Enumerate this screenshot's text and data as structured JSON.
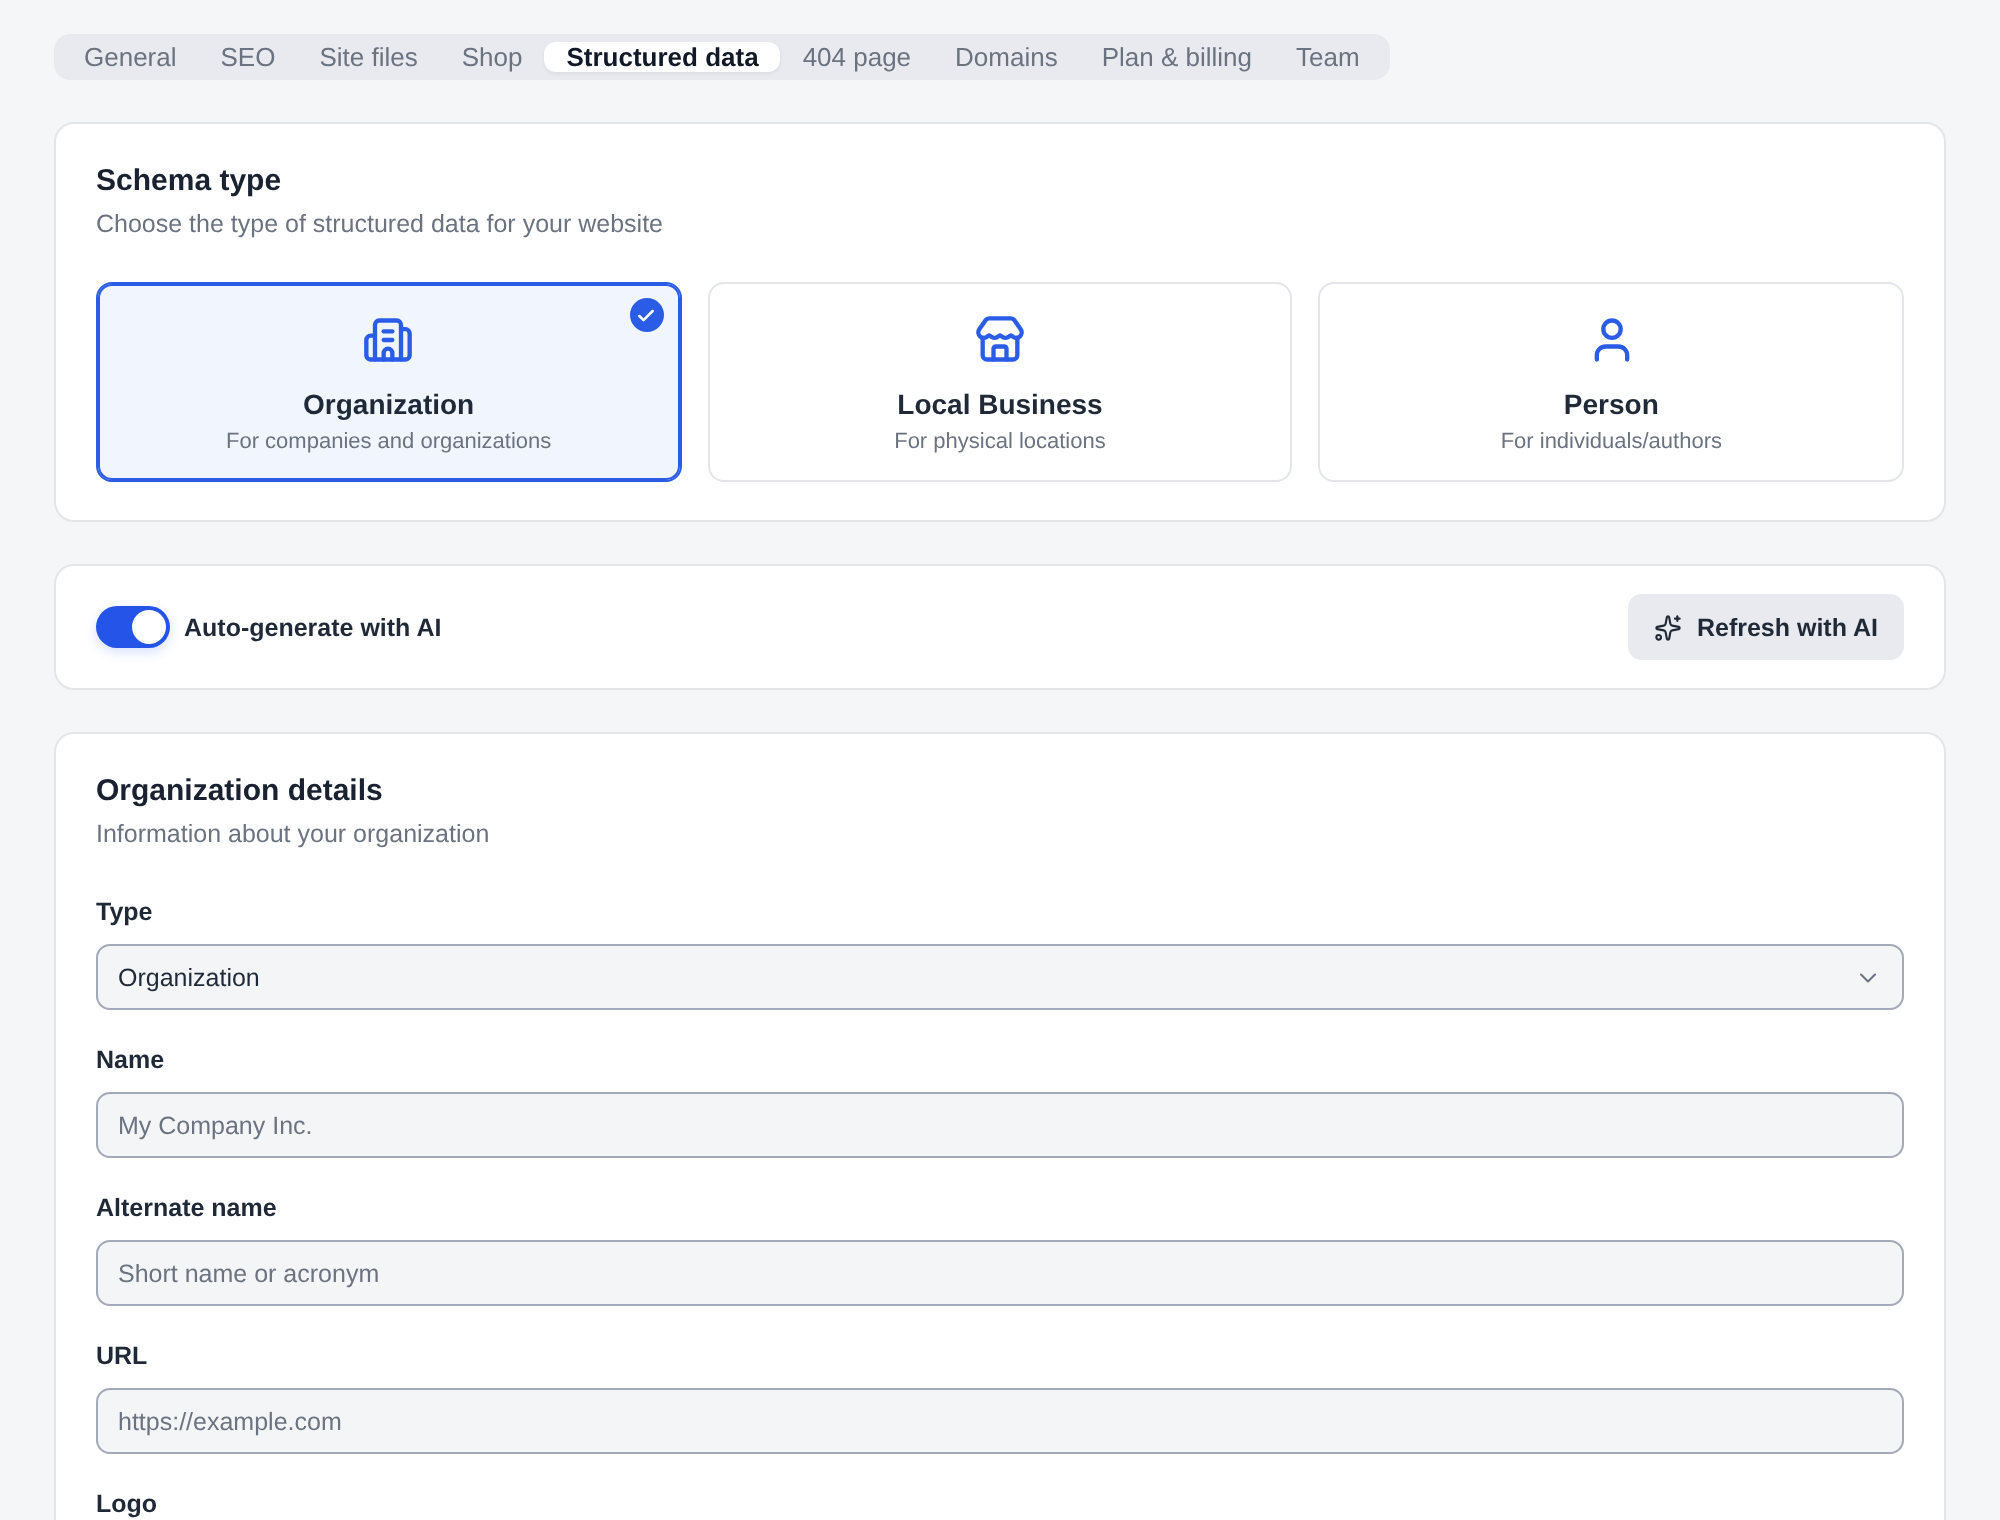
{
  "tabs": [
    {
      "label": "General",
      "selected": false
    },
    {
      "label": "SEO",
      "selected": false
    },
    {
      "label": "Site files",
      "selected": false
    },
    {
      "label": "Shop",
      "selected": false
    },
    {
      "label": "Structured data",
      "selected": true
    },
    {
      "label": "404 page",
      "selected": false
    },
    {
      "label": "Domains",
      "selected": false
    },
    {
      "label": "Plan & billing",
      "selected": false
    },
    {
      "label": "Team",
      "selected": false
    }
  ],
  "schema_type": {
    "title": "Schema type",
    "subtitle": "Choose the type of structured data for your website",
    "options": [
      {
        "kind": "building",
        "title": "Organization",
        "description": "For companies and organizations",
        "selected": true
      },
      {
        "kind": "store",
        "title": "Local Business",
        "description": "For physical locations",
        "selected": false
      },
      {
        "kind": "person",
        "title": "Person",
        "description": "For individuals/authors",
        "selected": false
      }
    ]
  },
  "ai": {
    "toggle": {
      "label": "Auto-generate with AI",
      "on": true
    },
    "button": "Refresh with AI"
  },
  "details": {
    "title": "Organization details",
    "subtitle": "Information about your organization",
    "fields": [
      {
        "kind": "select",
        "label": "Type",
        "value": "Organization"
      },
      {
        "kind": "text",
        "label": "Name",
        "placeholder": "My Company Inc."
      },
      {
        "kind": "text",
        "label": "Alternate name",
        "placeholder": "Short name or acronym"
      },
      {
        "kind": "text",
        "label": "URL",
        "placeholder": "https://example.com"
      },
      {
        "kind": "label",
        "label": "Logo"
      }
    ]
  }
}
